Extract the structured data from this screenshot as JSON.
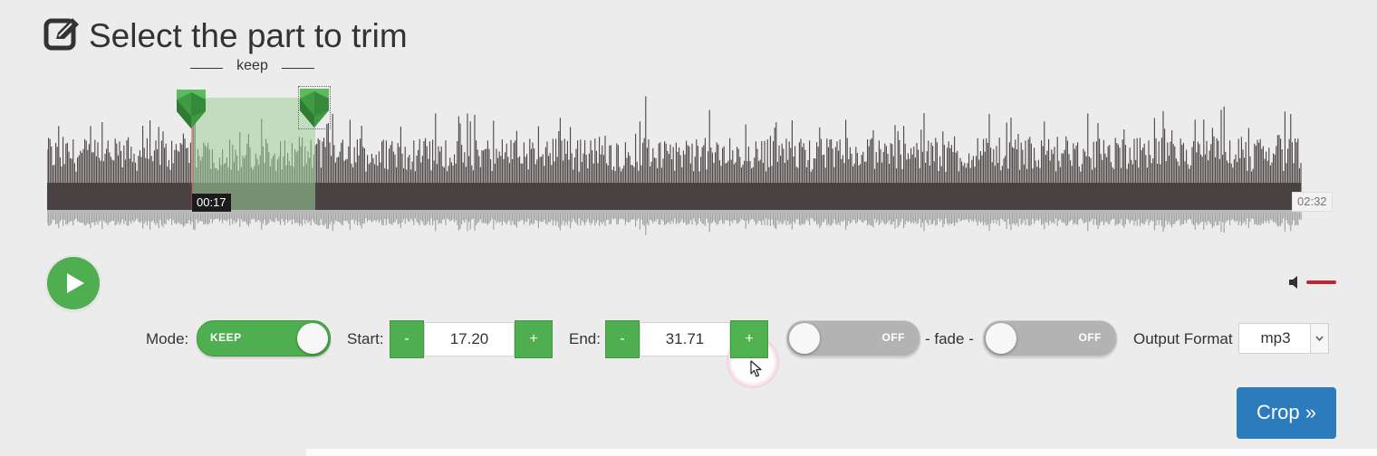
{
  "header": {
    "title": "Select the part to trim",
    "icon": "edit-icon"
  },
  "selection": {
    "label": "keep",
    "current_time": "00:17",
    "total_time": "02:32"
  },
  "player": {
    "play_icon": "play-icon",
    "volume_icon": "speaker-icon",
    "volume_color": "#b52a34"
  },
  "controls": {
    "mode_label": "Mode:",
    "mode_value": "KEEP",
    "start_label": "Start:",
    "start_value": "17.20",
    "end_label": "End:",
    "end_value": "31.71",
    "minus": "-",
    "plus": "+",
    "fade_in_value": "OFF",
    "fade_label": "- fade -",
    "fade_out_value": "OFF",
    "format_label": "Output Format",
    "format_value": "mp3",
    "crop_label": "Crop »"
  },
  "colors": {
    "accent_green": "#4fae4f",
    "crop_blue": "#2b7bbd",
    "waveform": "#4a4343",
    "waveform_reflection": "#9c9c9c",
    "selection_fill": "#b9dcb4"
  }
}
